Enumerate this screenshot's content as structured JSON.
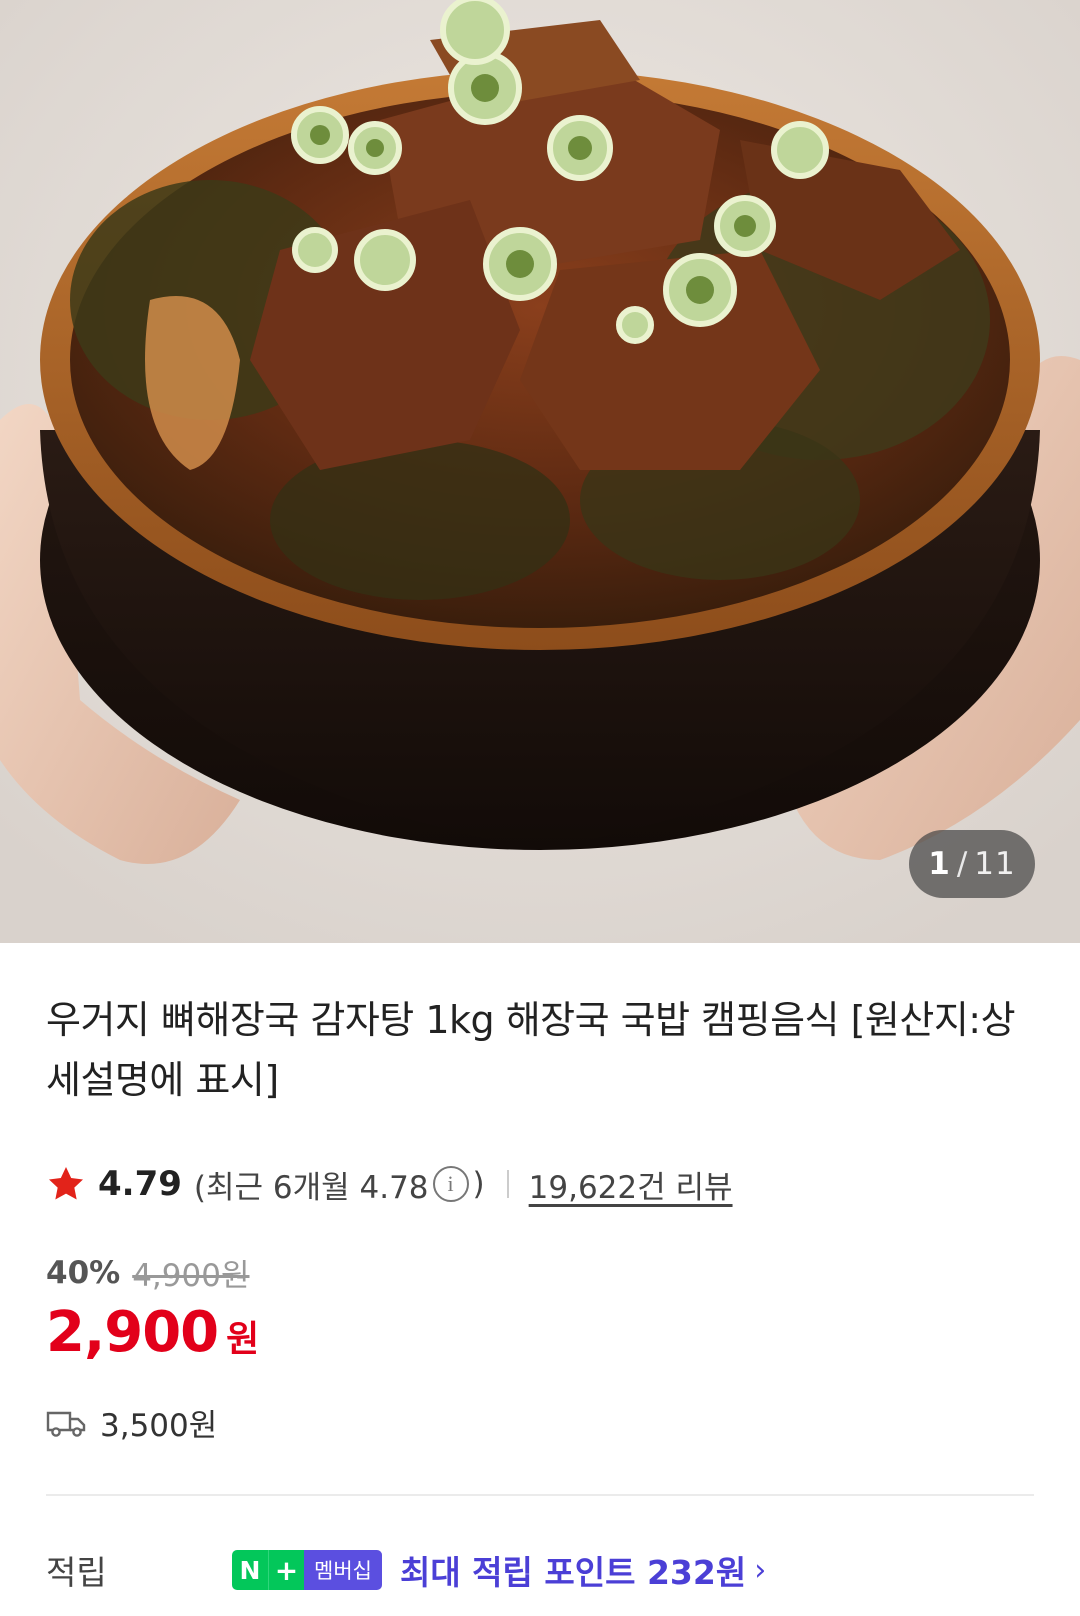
{
  "hero": {
    "image_alt": "우거지 뼈해장국",
    "counter": {
      "current": "1",
      "separator": "/",
      "total": "11"
    }
  },
  "product": {
    "title": "우거지 뼈해장국 감자탕 1kg 해장국 국밥 캠핑음식 [원산지:상세설명에 표시]",
    "rating": {
      "score": "4.79",
      "recent_prefix": "(최근 6개월 4.78",
      "recent_suffix": ")",
      "info_icon_text": "i",
      "review_count": "19,622건 리뷰"
    },
    "price": {
      "discount": "40%",
      "original": "4,900원",
      "current": "2,900",
      "unit": "원"
    },
    "shipping": {
      "fee": "3,500원"
    },
    "points": {
      "label": "적립",
      "badge_n": "N",
      "badge_plus": "+",
      "badge_membership": "멤버십",
      "text": "최대 적립 포인트 232원",
      "chevron": "›"
    }
  },
  "colors": {
    "price_red": "#e2001a",
    "star_red": "#e2231a",
    "naver_green": "#03c75a",
    "membership_purple": "#5b4fe0",
    "points_text": "#4b3fd6"
  },
  "icons": [
    "star-icon",
    "info-icon",
    "truck-icon",
    "chevron-right-icon"
  ]
}
